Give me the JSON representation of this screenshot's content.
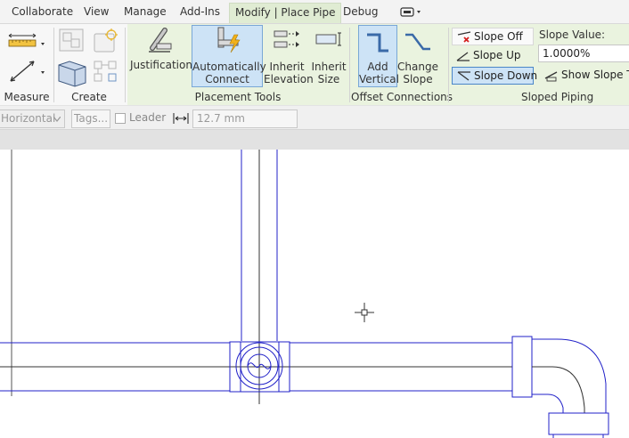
{
  "tabs": [
    {
      "label": "Collaborate",
      "active": false
    },
    {
      "label": "View",
      "active": false
    },
    {
      "label": "Manage",
      "active": false
    },
    {
      "label": "Add-Ins",
      "active": false
    },
    {
      "label": "Modify | Place Pipe",
      "active": true
    },
    {
      "label": "Debug",
      "active": false
    }
  ],
  "ribbon": {
    "measure": {
      "title": "Measure"
    },
    "create": {
      "title": "Create"
    },
    "placement_tools": {
      "title": "Placement Tools",
      "justification": "Justification",
      "auto_connect_line1": "Automatically",
      "auto_connect_line2": "Connect",
      "inherit_elev_line1": "Inherit",
      "inherit_elev_line2": "Elevation",
      "inherit_size_line1": "Inherit",
      "inherit_size_line2": "Size"
    },
    "offset_connections": {
      "title": "Offset Connections",
      "add_vertical_line1": "Add",
      "add_vertical_line2": "Vertical",
      "change_slope_line1": "Change",
      "change_slope_line2": "Slope"
    },
    "sloped_piping": {
      "title": "Sloped Piping",
      "slope_off": "Slope Off",
      "slope_up": "Slope Up",
      "slope_down": "Slope Down",
      "slope_value_label": "Slope Value:",
      "slope_value": "1.0000%",
      "show_slope_tooltip": "Show Slope To"
    }
  },
  "options_bar": {
    "orientation": "Horizontal",
    "tags_placeholder": "Tags...",
    "leader_label": "Leader",
    "leader_checked": false,
    "length_value": "12.7 mm"
  },
  "colors": {
    "pipe_line": "#2020c8",
    "selected_button": "#cde3f6",
    "active_panel": "#eaf3df"
  }
}
